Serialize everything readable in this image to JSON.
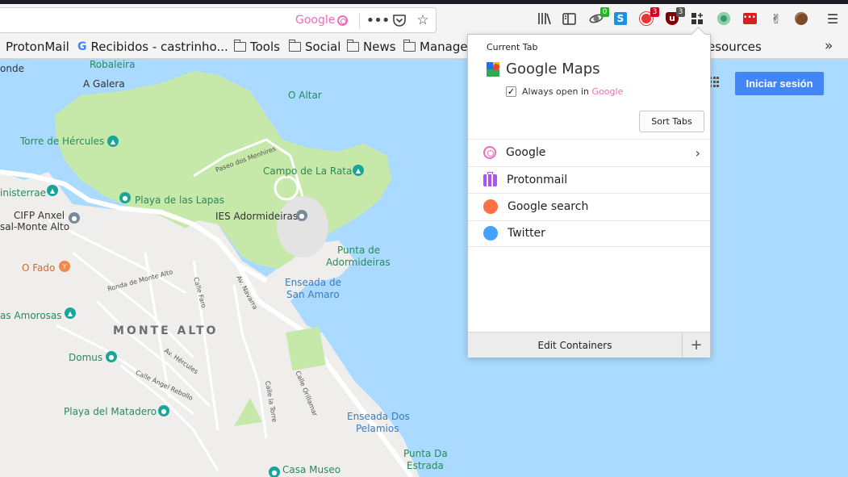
{
  "browser": {
    "url_container_label": "Google",
    "toolbar_badges": {
      "ext1": "0",
      "ext2": "3",
      "ublock": "3"
    }
  },
  "bookmarks": [
    {
      "label": "ProtonMail",
      "type": "site"
    },
    {
      "label": "Recibidos - castrinho...",
      "type": "google"
    },
    {
      "label": "Tools",
      "type": "folder"
    },
    {
      "label": "Social",
      "type": "folder"
    },
    {
      "label": "News",
      "type": "folder"
    },
    {
      "label": "Manager",
      "type": "folder"
    },
    {
      "label": "esources",
      "type": "folder"
    }
  ],
  "map": {
    "labels": {
      "robaleira": "Robaleira",
      "a_galera": "A Galera",
      "o_altar": "O Altar",
      "torre": "Torre de Hércules",
      "campo": "Campo de La Rata",
      "finisterrae": "inisterrae",
      "lapas": "Playa de las Lapas",
      "cifp": "CIFP Anxel",
      "salmonte": "sal-Monte Alto",
      "ies": "IES Adormideiras",
      "punta_ador": "Punta de",
      "punta_ador2": "Adormideiras",
      "ofado": "O Fado",
      "enseada_sa": "Enseada de",
      "enseada_sa2": "San Amaro",
      "amorosas": "as Amorosas",
      "monte_alto": "MONTE ALTO",
      "domus": "Domus",
      "matadero": "Playa del Matadero",
      "enseada_dp": "Enseada Dos",
      "enseada_dp2": "Pelamios",
      "punta_estrada": "Punta Da",
      "punta_estrada2": "Estrada",
      "casa_museo": "Casa Museo",
      "onde": "onde",
      "paseo": "Paseo dos Menhires",
      "ronda": "Ronda de Monte Alto",
      "calle_faro": "Calle Faro",
      "av_navarra": "Av. Navarra",
      "av_hercules": "Av. Hércules",
      "angel": "Calle Ángel Rebollo",
      "torre_st": "Calle la Torre",
      "orillamar": "Calle Orillamar"
    },
    "signin_label": "Iniciar sesión"
  },
  "popup": {
    "heading": "Current Tab",
    "site": "Google Maps",
    "always_open_prefix": "Always open in",
    "always_open_container": "Google",
    "always_open_checked": true,
    "sort_tabs_label": "Sort Tabs",
    "containers": [
      {
        "name": "Google",
        "icon": "fingerprint-icon",
        "color": "#f06bbd",
        "has_arrow": true
      },
      {
        "name": "Protonmail",
        "icon": "briefcase-icon",
        "color": "#af51f5",
        "has_arrow": false
      },
      {
        "name": "Google search",
        "icon": "circle-icon",
        "color": "#ff7045",
        "has_arrow": false
      },
      {
        "name": "Twitter",
        "icon": "circle-icon",
        "color": "#45a1ff",
        "has_arrow": false
      }
    ],
    "edit_label": "Edit Containers",
    "add_label": "+"
  }
}
